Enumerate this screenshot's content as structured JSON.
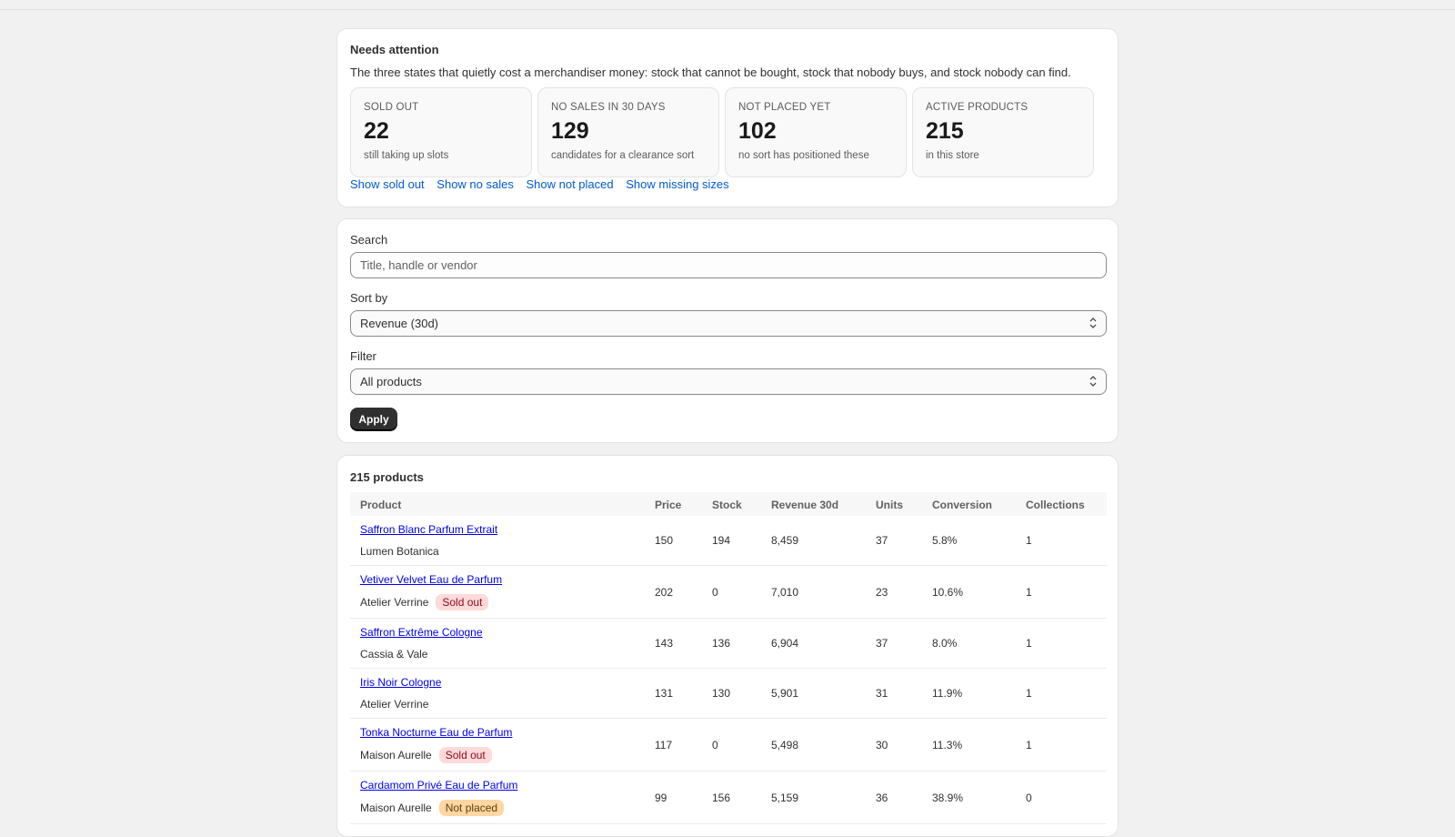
{
  "attention": {
    "title": "Needs attention",
    "description": "The three states that quietly cost a merchandiser money: stock that cannot be bought, stock that nobody buys, and stock nobody can find.",
    "stats": [
      {
        "label": "SOLD OUT",
        "value": "22",
        "sub": "still taking up slots"
      },
      {
        "label": "NO SALES IN 30 DAYS",
        "value": "129",
        "sub": "candidates for a clearance sort"
      },
      {
        "label": "NOT PLACED YET",
        "value": "102",
        "sub": "no sort has positioned these"
      },
      {
        "label": "ACTIVE PRODUCTS",
        "value": "215",
        "sub": "in this store"
      }
    ],
    "links": [
      "Show sold out",
      "Show no sales",
      "Show not placed",
      "Show missing sizes"
    ]
  },
  "filters": {
    "search_label": "Search",
    "search_placeholder": "Title, handle or vendor",
    "sort_label": "Sort by",
    "sort_value": "Revenue (30d)",
    "filter_label": "Filter",
    "filter_value": "All products",
    "apply_label": "Apply"
  },
  "products": {
    "count_label": "215 products",
    "columns": [
      "Product",
      "Price",
      "Stock",
      "Revenue 30d",
      "Units",
      "Conversion",
      "Collections"
    ],
    "rows": [
      {
        "name": "Saffron Blanc Parfum Extrait",
        "vendor": "Lumen Botanica",
        "badge": "",
        "price": "150",
        "stock": "194",
        "revenue": "8,459",
        "units": "37",
        "conversion": "5.8%",
        "collections": "1"
      },
      {
        "name": "Vetiver Velvet Eau de Parfum",
        "vendor": "Atelier Verrine",
        "badge": "Sold out",
        "price": "202",
        "stock": "0",
        "revenue": "7,010",
        "units": "23",
        "conversion": "10.6%",
        "collections": "1"
      },
      {
        "name": "Saffron Extrême Cologne",
        "vendor": "Cassia & Vale",
        "badge": "",
        "price": "143",
        "stock": "136",
        "revenue": "6,904",
        "units": "37",
        "conversion": "8.0%",
        "collections": "1"
      },
      {
        "name": "Iris Noir Cologne",
        "vendor": "Atelier Verrine",
        "badge": "",
        "price": "131",
        "stock": "130",
        "revenue": "5,901",
        "units": "31",
        "conversion": "11.9%",
        "collections": "1"
      },
      {
        "name": "Tonka Nocturne Eau de Parfum",
        "vendor": "Maison Aurelle",
        "badge": "Sold out",
        "price": "117",
        "stock": "0",
        "revenue": "5,498",
        "units": "30",
        "conversion": "11.3%",
        "collections": "1"
      },
      {
        "name": "Cardamom Privé Eau de Parfum",
        "vendor": "Maison Aurelle",
        "badge": "Not placed",
        "price": "99",
        "stock": "156",
        "revenue": "5,159",
        "units": "36",
        "conversion": "38.9%",
        "collections": "0"
      }
    ]
  },
  "colors": {
    "link": "#005bd3",
    "sold_out_bg": "#fedad9",
    "not_placed_bg": "#ffd6a4",
    "button": "#303030"
  }
}
